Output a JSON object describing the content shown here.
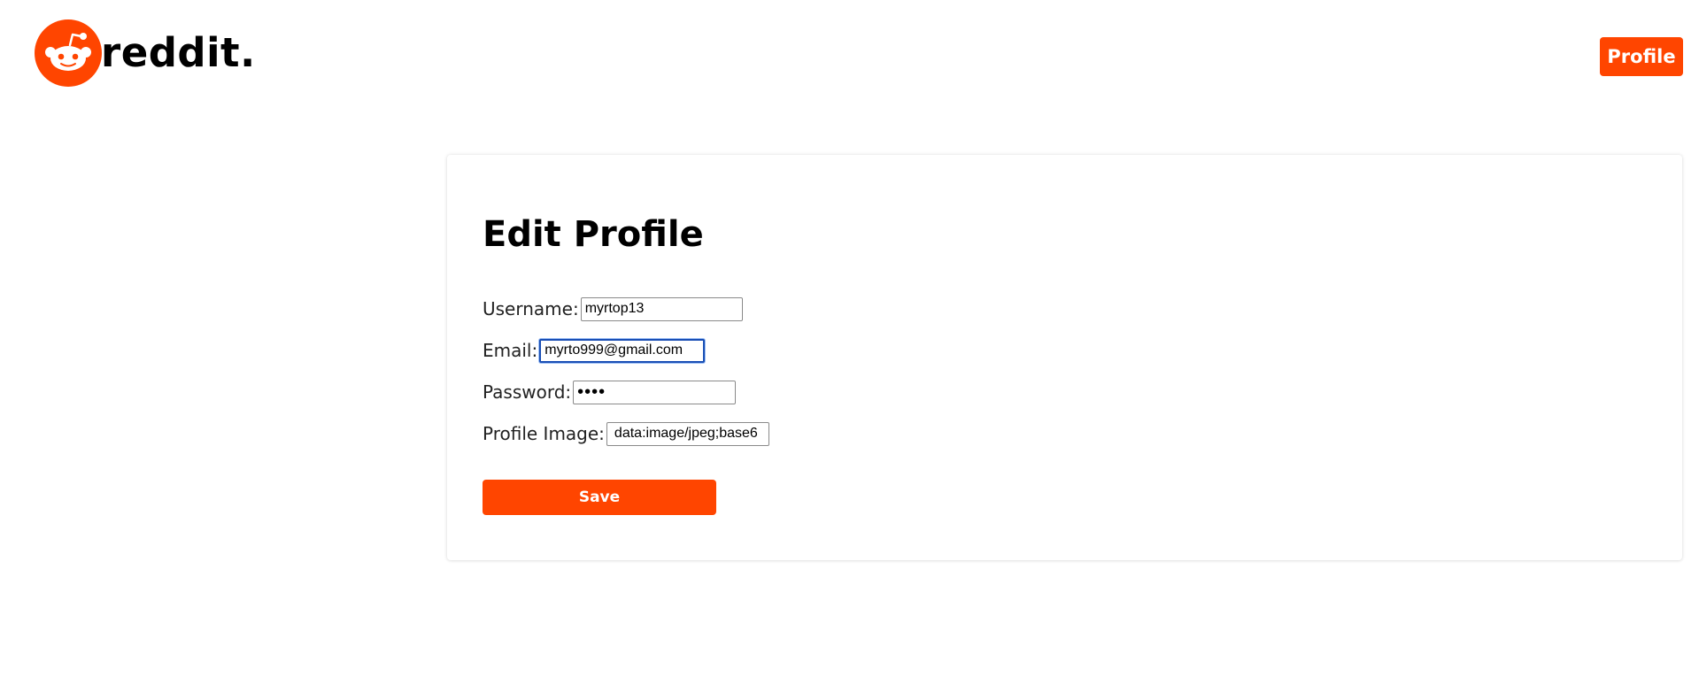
{
  "brand": {
    "logo_icon": "reddit-snoo-icon",
    "name": "reddit.",
    "accent_color": "#ff4500"
  },
  "header": {
    "profile_label": "Profile"
  },
  "form": {
    "title": "Edit Profile",
    "username": {
      "label": "Username:",
      "value": "myrtop13"
    },
    "email": {
      "label": "Email:",
      "value": "myrto999@gmail.com"
    },
    "password": {
      "label": "Password:",
      "value": "••••"
    },
    "profile_image": {
      "label": "Profile Image:",
      "value": "data:image/jpeg;base6"
    },
    "save_label": "Save"
  }
}
